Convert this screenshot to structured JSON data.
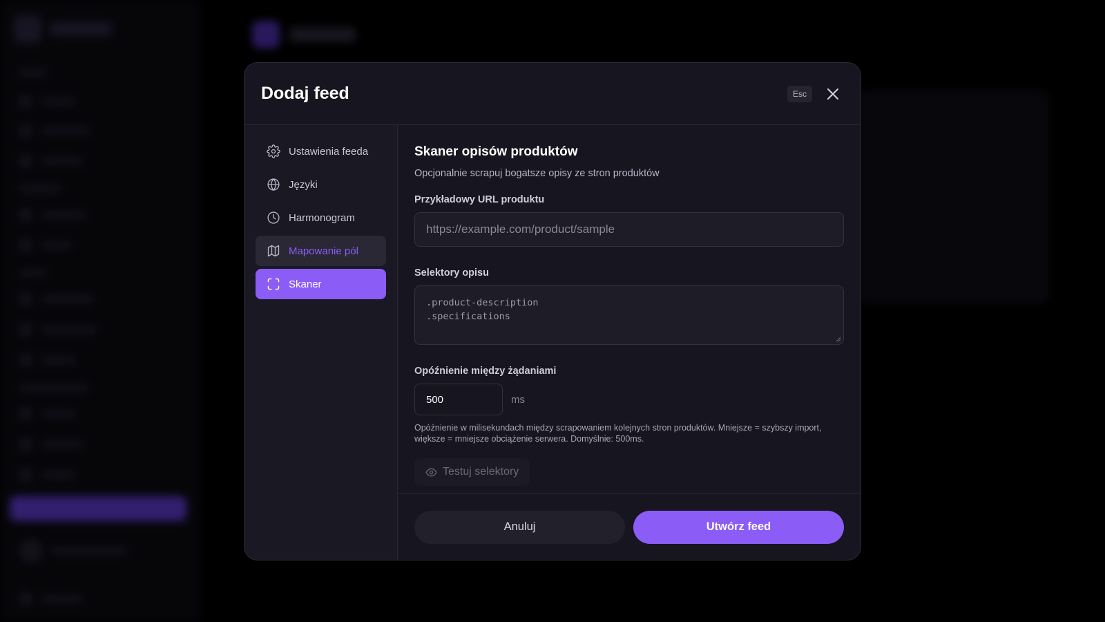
{
  "modal": {
    "title": "Dodaj feed",
    "esc_label": "Esc"
  },
  "tabs": [
    {
      "label": "Ustawienia feeda",
      "icon": "gear-icon"
    },
    {
      "label": "Języki",
      "icon": "globe-icon"
    },
    {
      "label": "Harmonogram",
      "icon": "clock-icon"
    },
    {
      "label": "Mapowanie pól",
      "icon": "map-icon"
    },
    {
      "label": "Skaner",
      "icon": "scan-icon"
    }
  ],
  "scanner": {
    "title": "Skaner opisów produktów",
    "description": "Opcjonalnie scrapuj bogatsze opisy ze stron produktów",
    "url_label": "Przykładowy URL produktu",
    "url_placeholder": "https://example.com/product/sample",
    "selectors_label": "Selektory opisu",
    "selectors_lines": [
      ".product-description",
      ".specifications"
    ],
    "delay_label": "Opóźnienie między żądaniami",
    "delay_value": "500",
    "delay_unit": "ms",
    "delay_help": "Opóźnienie w milisekundach między scrapowaniem kolejnych stron produktów. Mniejsze = szybszy import, większe = mniejsze obciążenie serwera. Domyślnie: 500ms.",
    "test_button": "Testuj selektory"
  },
  "footer": {
    "cancel_label": "Anuluj",
    "submit_label": "Utwórz feed"
  },
  "colors": {
    "accent": "#8b5cf6",
    "modal_bg": "#17151f",
    "page_bg": "#000000"
  }
}
